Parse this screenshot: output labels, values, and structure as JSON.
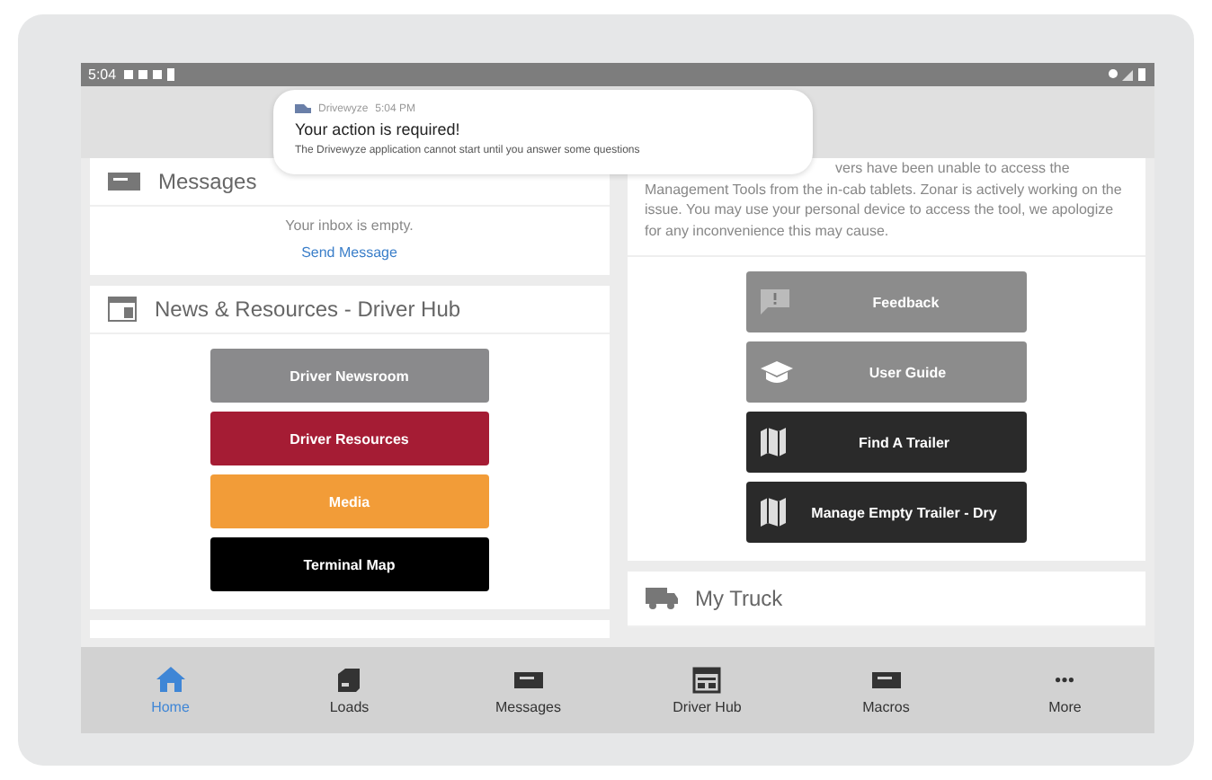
{
  "status_bar": {
    "time": "5:04"
  },
  "notification": {
    "app": "Drivewyze",
    "time": "5:04 PM",
    "title": "Your action is required!",
    "body": "The Drivewyze application cannot start until you answer some questions"
  },
  "messages_card": {
    "title": "Messages",
    "empty_text": "Your inbox is empty.",
    "link": "Send Message"
  },
  "news_card": {
    "title": "News & Resources - Driver Hub",
    "buttons": [
      {
        "label": "Driver Newsroom",
        "color": "#8a8a8c"
      },
      {
        "label": "Driver Resources",
        "color": "#a51c34"
      },
      {
        "label": "Media",
        "color": "#f29c38"
      },
      {
        "label": "Terminal Map",
        "color": "#000000"
      }
    ]
  },
  "notice_card": {
    "first_line": "vers have been unable to access the",
    "text": "Management Tools from the in-cab tablets. Zonar is actively working on the issue. You may use your personal device to access the tool, we apologize for any inconvenience this may cause.",
    "buttons": [
      {
        "label": "Feedback",
        "kind": "feedback",
        "color": "#8c8c8c"
      },
      {
        "label": "User Guide",
        "kind": "guide",
        "color": "#8c8c8c"
      },
      {
        "label": "Find A Trailer",
        "kind": "map",
        "color": "#2a2a2a"
      },
      {
        "label": "Manage Empty Trailer - Dry",
        "kind": "map",
        "color": "#2a2a2a"
      }
    ]
  },
  "truck_card": {
    "title": "My Truck"
  },
  "nav": [
    {
      "label": "Home",
      "kind": "home",
      "selected": true
    },
    {
      "label": "Loads",
      "kind": "loads",
      "selected": false
    },
    {
      "label": "Messages",
      "kind": "message",
      "selected": false
    },
    {
      "label": "Driver Hub",
      "kind": "hub",
      "selected": false
    },
    {
      "label": "Macros",
      "kind": "message",
      "selected": false
    },
    {
      "label": "More",
      "kind": "more",
      "selected": false
    }
  ]
}
